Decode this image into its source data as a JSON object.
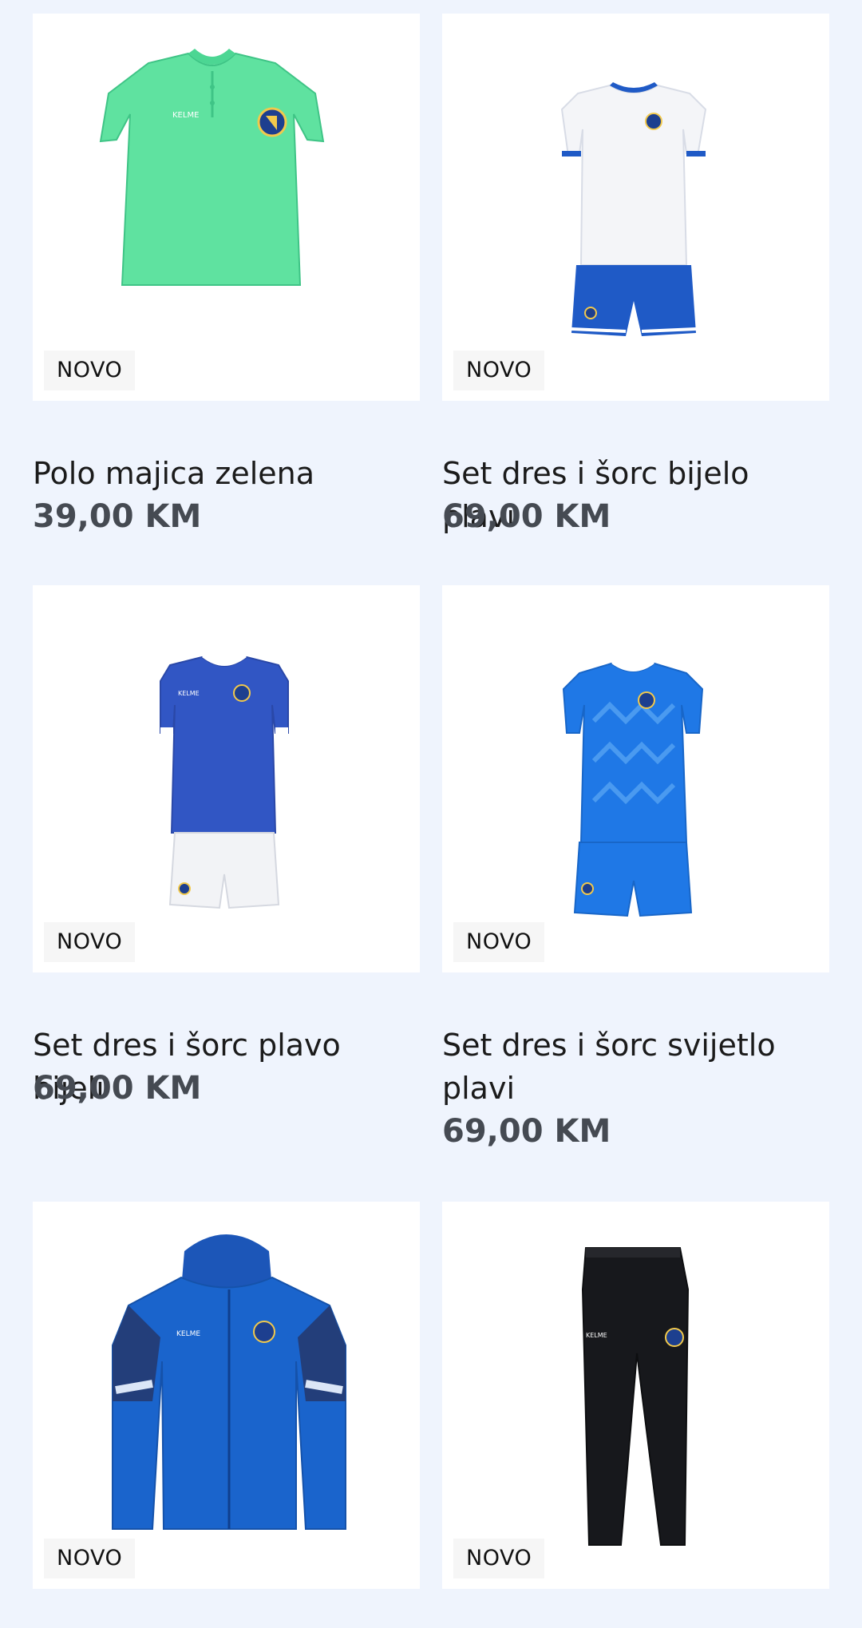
{
  "products": [
    {
      "badge": "NOVO",
      "title": "Polo majica zelena",
      "price": "39,00 KM",
      "image": "green-polo-shirt"
    },
    {
      "badge": "NOVO",
      "title": "Set dres i šorc bijelo plavi",
      "price": "69,00 KM",
      "image": "white-blue-kit"
    },
    {
      "badge": "NOVO",
      "title": "Set dres i šorc plavo bijeli",
      "price": "69,00 KM",
      "image": "blue-white-kit"
    },
    {
      "badge": "NOVO",
      "title": "Set dres i šorc svijetlo plavi",
      "price": "69,00 KM",
      "image": "light-blue-kit"
    },
    {
      "badge": "NOVO",
      "title": "",
      "price": "",
      "image": "blue-rain-jacket"
    },
    {
      "badge": "NOVO",
      "title": "",
      "price": "",
      "image": "black-training-pants"
    }
  ],
  "colors": {
    "background": "#eff4fd",
    "price": "#454a52",
    "title": "#1b1b1b"
  }
}
